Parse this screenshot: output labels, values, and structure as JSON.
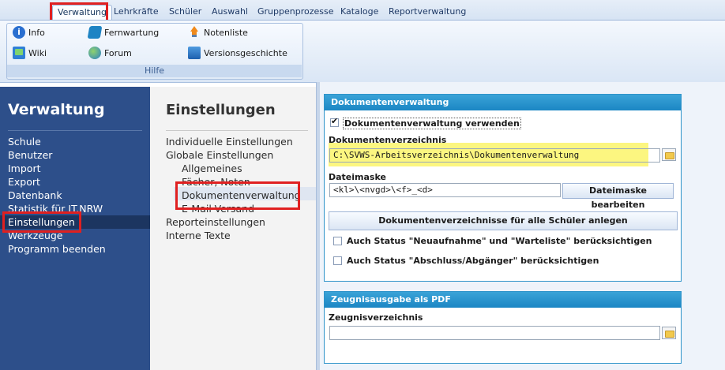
{
  "ribbon": {
    "tabs": [
      "Verwaltung",
      "Lehrkräfte",
      "Schüler",
      "Auswahl",
      "Gruppenprozesse",
      "Kataloge",
      "Reportverwaltung"
    ],
    "active_tab": "Verwaltung",
    "group_label": "Hilfe",
    "buttons": {
      "info": "Info",
      "wiki": "Wiki",
      "fernwartung": "Fernwartung",
      "forum": "Forum",
      "notenliste": "Notenliste",
      "versionsgeschichte": "Versionsgeschichte"
    }
  },
  "nav": {
    "title": "Verwaltung",
    "items": [
      "Schule",
      "Benutzer",
      "Import",
      "Export",
      "Datenbank",
      "Statistik für IT.NRW",
      "Einstellungen",
      "Werkzeuge",
      "Programm beenden"
    ],
    "selected": "Einstellungen"
  },
  "settings": {
    "title": "Einstellungen",
    "items": [
      "Individuelle Einstellungen",
      "Globale Einstellungen",
      "Allgemeines",
      "Fächer, Noten",
      "Dokumentenverwaltung",
      "E-Mail-Versand",
      "Reporteinstellungen",
      "Interne Texte"
    ],
    "selected": "Dokumentenverwaltung"
  },
  "dokumentenverwaltung": {
    "header": "Dokumentenverwaltung",
    "use_label": "Dokumentenverwaltung verwenden",
    "use_checked": true,
    "dir_label": "Dokumentenverzeichnis",
    "dir_value": "C:\\SVWS-Arbeitsverzeichnis\\Dokumentenverwaltung",
    "mask_label": "Dateimaske",
    "mask_value": "<kl>\\<nvgd>\\<f>_<d>",
    "mask_button": "Dateimaske bearbeiten",
    "create_button": "Dokumentenverzeichnisse für alle Schüler anlegen",
    "check_new_label": "Auch Status \"Neuaufnahme\" und \"Warteliste\" berücksichtigen",
    "check_new_checked": false,
    "check_abschluss_label": "Auch Status \"Abschluss/Abgänger\" berücksichtigen",
    "check_abschluss_checked": false
  },
  "zeugnis": {
    "header": "Zeugnisausgabe als PDF",
    "dir_label": "Zeugnisverzeichnis",
    "dir_value": ""
  },
  "colors": {
    "nav_bg": "#2d4f8a",
    "panel_header": "#1b86c4",
    "highlight_red": "#e02020",
    "highlight_yellow": "#fbf56a"
  }
}
